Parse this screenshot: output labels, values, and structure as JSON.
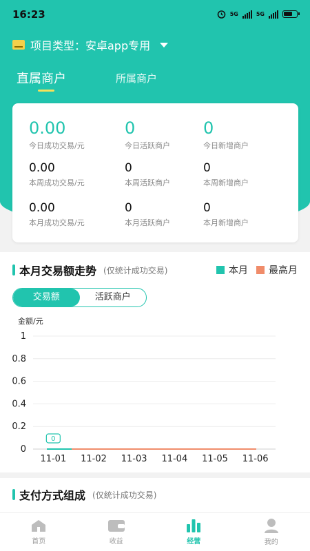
{
  "status": {
    "time": "16:23",
    "net1": "5G",
    "net2": "5G"
  },
  "project": {
    "label": "项目类型：安卓app专用",
    "icon": "folder-icon"
  },
  "tabs": [
    {
      "label": "直属商户",
      "active": true
    },
    {
      "label": "所属商户",
      "active": false
    }
  ],
  "stats": [
    {
      "value": "0.00",
      "label": "今日成功交易/元"
    },
    {
      "value": "0",
      "label": "今日活跃商户"
    },
    {
      "value": "0",
      "label": "今日新增商户"
    },
    {
      "value": "0.00",
      "label": "本周成功交易/元"
    },
    {
      "value": "0",
      "label": "本周活跃商户"
    },
    {
      "value": "0",
      "label": "本周新增商户"
    },
    {
      "value": "0.00",
      "label": "本月成功交易/元"
    },
    {
      "value": "0",
      "label": "本月活跃商户"
    },
    {
      "value": "0",
      "label": "本月新增商户"
    }
  ],
  "trend": {
    "title": "本月交易额走势",
    "subtitle": "(仅统计成功交易)",
    "toggle": {
      "on": "交易额",
      "off": "活跃商户"
    }
  },
  "pay": {
    "title": "支付方式组成",
    "subtitle": "(仅统计成功交易)"
  },
  "nav": [
    {
      "label": "首页",
      "icon": "home-icon",
      "active": false
    },
    {
      "label": "收益",
      "icon": "wallet-icon",
      "active": false
    },
    {
      "label": "经营",
      "icon": "bar-chart-icon",
      "active": true
    },
    {
      "label": "我的",
      "icon": "user-icon",
      "active": false
    }
  ],
  "colors": {
    "accent": "#21c4ae",
    "highlight": "#f6e15a",
    "max_series": "#f08c6a"
  },
  "chart_data": {
    "type": "line",
    "ylabel": "金额/元",
    "ylim": [
      0,
      1
    ],
    "yticks": [
      "1",
      "0.8",
      "0.6",
      "0.4",
      "0.2",
      "0"
    ],
    "categories": [
      "11-01",
      "11-02",
      "11-03",
      "11-04",
      "11-05",
      "11-06"
    ],
    "series": [
      {
        "name": "本月",
        "color": "#21c4ae",
        "values": [
          0,
          0,
          0,
          0,
          0,
          0
        ]
      },
      {
        "name": "最高月",
        "color": "#f08c6a",
        "values": [
          0,
          0,
          0,
          0,
          0,
          0
        ]
      }
    ],
    "annotations": [
      "0"
    ],
    "grid": true,
    "legend": "top-right"
  }
}
